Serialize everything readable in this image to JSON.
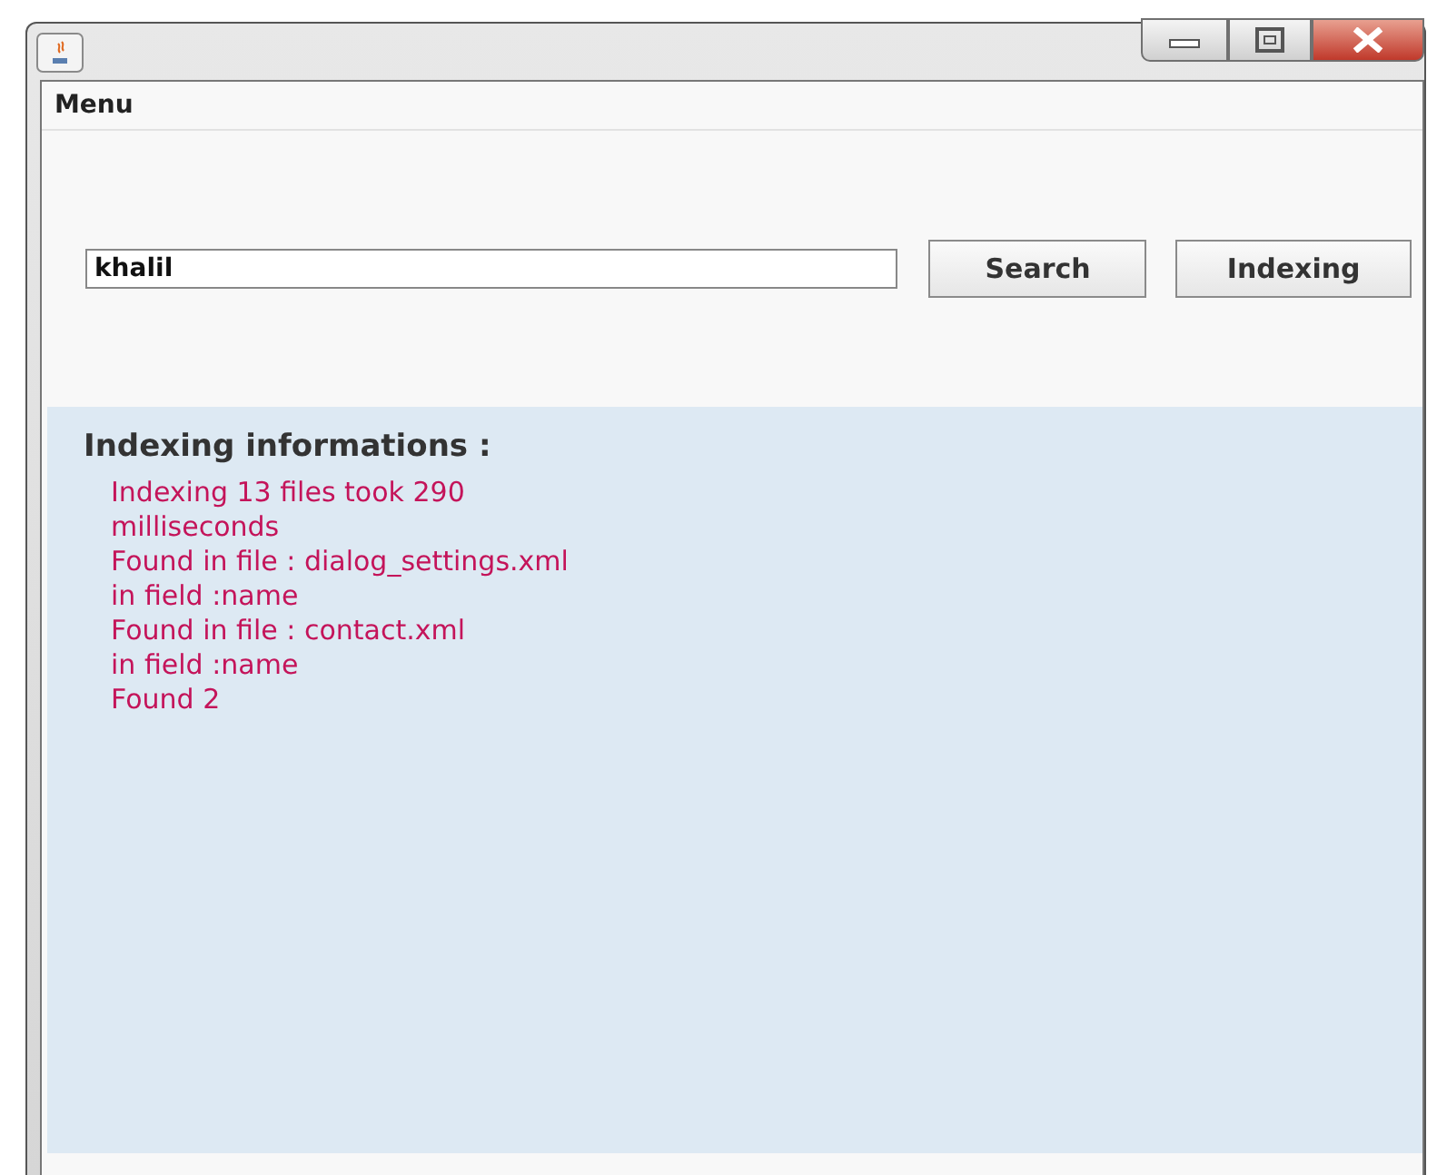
{
  "menu_bar": {
    "items": [
      "Menu"
    ]
  },
  "search": {
    "value": "khalil"
  },
  "buttons": [
    "Search",
    "Indexing"
  ],
  "info_panel": {
    "heading": "Indexing informations :",
    "lines": [
      "Indexing 13 files took 290",
      "milliseconds",
      "Found in file : dialog_settings.xml",
      "in field :name",
      "Found in file : contact.xml",
      "in field :name",
      "Found 2"
    ]
  }
}
